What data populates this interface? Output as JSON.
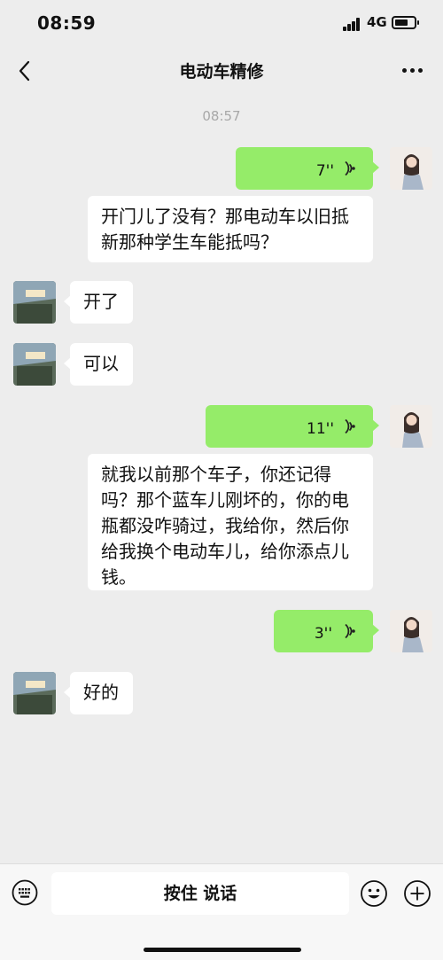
{
  "status_bar": {
    "time": "08:59",
    "network": "4G"
  },
  "header": {
    "title": "电动车精修"
  },
  "chat": {
    "timestamp": "08:57",
    "messages": [
      {
        "sender": "self",
        "type": "voice",
        "duration": "7''"
      },
      {
        "sender": "self",
        "type": "text",
        "text": "开门儿了没有？那电动车以旧抵新那种学生车能抵吗？"
      },
      {
        "sender": "other",
        "type": "text",
        "text": "开了"
      },
      {
        "sender": "other",
        "type": "text",
        "text": "可以"
      },
      {
        "sender": "self",
        "type": "voice",
        "duration": "11''"
      },
      {
        "sender": "self",
        "type": "text",
        "text": "就我以前那个车子，你还记得吗？那个蓝车儿刚坏的，你的电瓶都没咋骑过，我给你，然后你给我换个电动车儿，给你添点儿钱。"
      },
      {
        "sender": "self",
        "type": "voice",
        "duration": "3''"
      },
      {
        "sender": "other",
        "type": "text",
        "text": "好的"
      }
    ]
  },
  "input_bar": {
    "hold_to_talk": "按住 说话"
  },
  "icons": {
    "back": "chevron-left-icon",
    "more": "more-dots-icon",
    "voice": "voice-wave-icon",
    "keyboard": "keyboard-icon",
    "emoji": "emoji-icon",
    "add": "plus-circle-icon"
  },
  "colors": {
    "self_bubble": "#95ec69",
    "other_bubble": "#ffffff",
    "background": "#ededed"
  }
}
